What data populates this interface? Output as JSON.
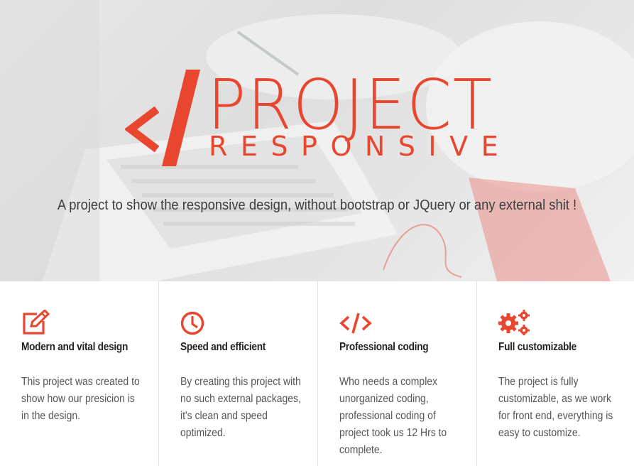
{
  "hero": {
    "logo_title": "PROJECT",
    "logo_subtitle": "RESPONSIVE",
    "tagline": "A project to show the responsive design, without bootstrap or JQuery or any external shit !"
  },
  "colors": {
    "accent": "#e8462f",
    "hero_bg": "#e4e4e4"
  },
  "features": [
    {
      "icon": "edit-icon",
      "title": "Modern and vital design",
      "text": "This project was created to show how our presicion is in the design."
    },
    {
      "icon": "clock-icon",
      "title": "Speed and efficient",
      "text": "By creating this project with no such external packages, it's clean and speed optimized."
    },
    {
      "icon": "code-icon",
      "title": "Professional coding",
      "text": "Who needs a complex unorganized coding, professional coding of project took us 12 Hrs to complete."
    },
    {
      "icon": "gears-icon",
      "title": "Full customizable",
      "text": "The project is fully customizable, as we work for front end, everything is easy to customize."
    }
  ]
}
